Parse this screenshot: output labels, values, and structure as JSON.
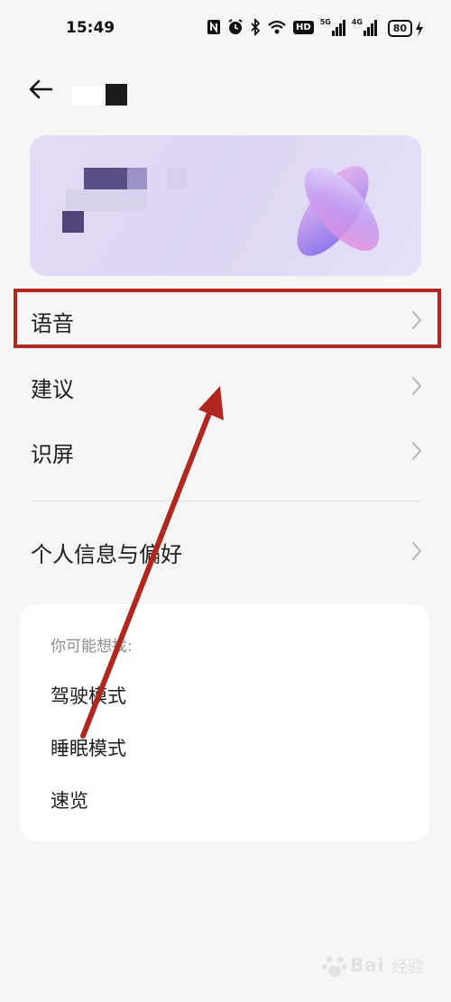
{
  "status_bar": {
    "time": "15:49",
    "icons": [
      "nfc-icon",
      "alarm-icon",
      "bluetooth-icon",
      "wifi-icon",
      "hd-icon",
      "signal-5g-icon",
      "signal-4g-icon"
    ],
    "hd_label": "HD",
    "net1_label": "5G",
    "net2_label": "4G",
    "battery": "80"
  },
  "menu": {
    "items": [
      {
        "label": "语音"
      },
      {
        "label": "建议"
      },
      {
        "label": "识屏"
      },
      {
        "label": "个人信息与偏好"
      }
    ]
  },
  "suggestions": {
    "heading": "你可能想找:",
    "items": [
      {
        "label": "驾驶模式"
      },
      {
        "label": "睡眠模式"
      },
      {
        "label": "速览"
      }
    ]
  },
  "annotation": {
    "highlight_color": "#b0271f"
  },
  "watermark": {
    "brand": "Bai",
    "suffix": "经验"
  }
}
